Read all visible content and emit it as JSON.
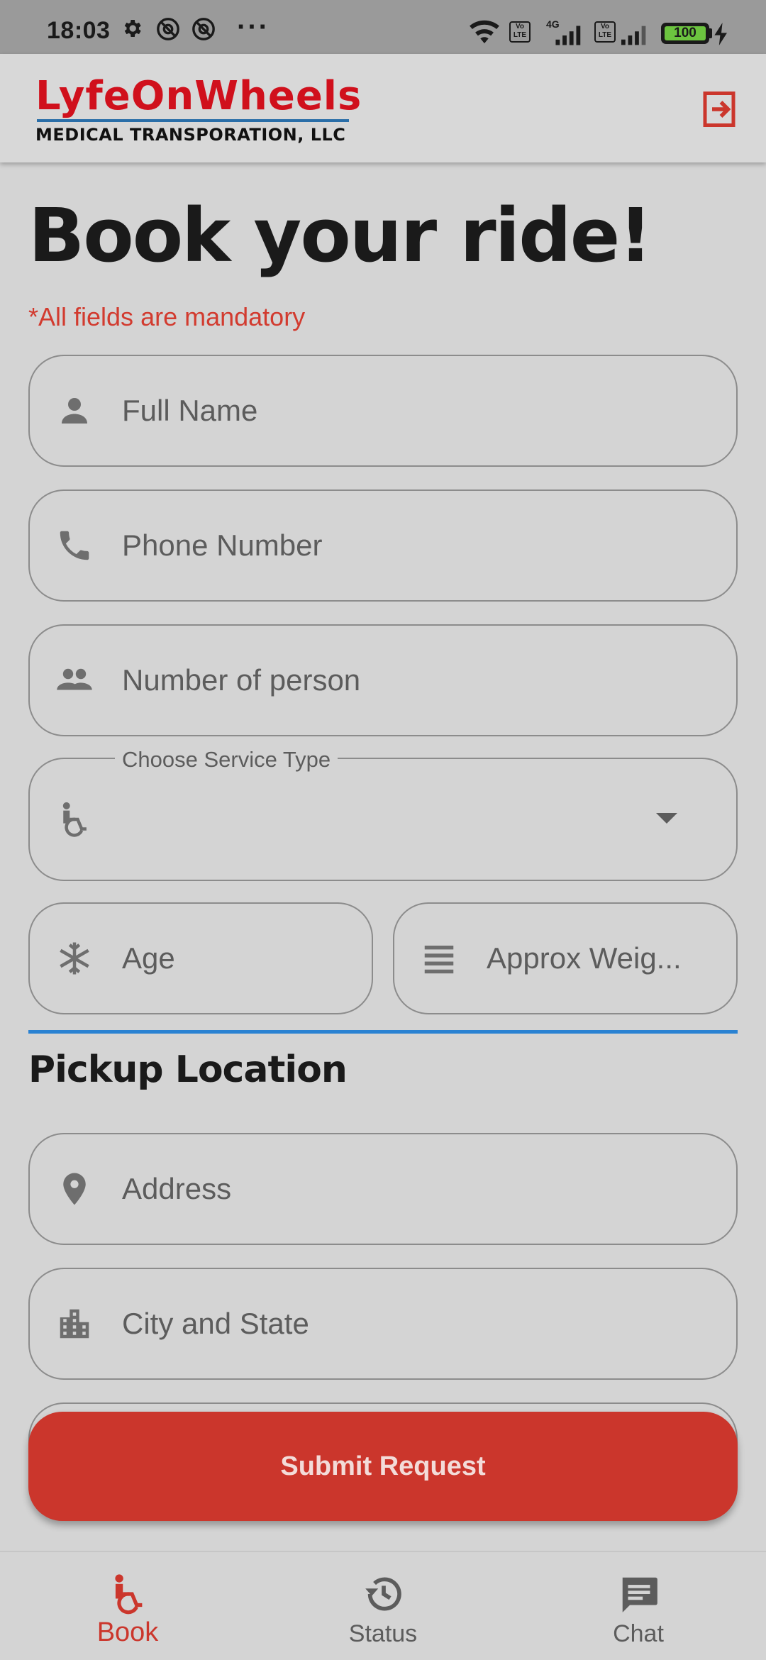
{
  "status_bar": {
    "time": "18:03",
    "more": "···",
    "volte_1": "Vo LTE",
    "network": "4G",
    "volte_2": "Vo LTE",
    "battery": "100"
  },
  "header": {
    "logo_top": "LyfeOnWheels",
    "logo_bottom": "MEDICAL TRANSPORATION, LLC",
    "logout_icon": "logout-icon"
  },
  "form": {
    "title": "Book your ride!",
    "mandatory_note": "*All fields are mandatory",
    "full_name_placeholder": "Full Name",
    "phone_placeholder": "Phone Number",
    "persons_placeholder": "Number of person",
    "service_type_label": "Choose Service Type",
    "service_type_value": "",
    "age_placeholder": "Age",
    "weight_placeholder": "Approx Weig...",
    "pickup_title": "Pickup Location",
    "address_placeholder": "Address",
    "city_state_placeholder": "City and State",
    "submit_label": "Submit Request"
  },
  "bottom_nav": {
    "items": [
      {
        "label": "Book",
        "icon": "wheelchair-icon",
        "active": true
      },
      {
        "label": "Status",
        "icon": "history-icon",
        "active": false
      },
      {
        "label": "Chat",
        "icon": "chat-icon",
        "active": false
      }
    ]
  },
  "colors": {
    "accent_red": "#cb362c",
    "divider_blue": "#2a82d2",
    "background": "#d4d4d4",
    "icon_gray": "#6e6e6e"
  }
}
